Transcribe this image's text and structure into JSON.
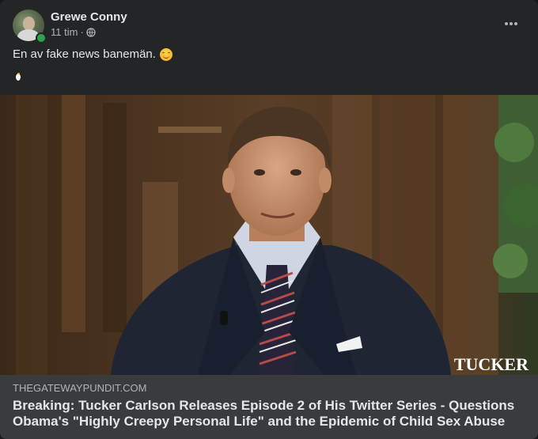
{
  "post": {
    "author": "Grewe Conny",
    "time": "11 tim",
    "separator": "·",
    "text": "En av fake news banemän.",
    "text_emoji": "smiling-face-with-smiling-eyes-icon",
    "second_line_emoji": "penguin-icon",
    "more_icon": "ellipsis-icon",
    "privacy_icon": "globe-icon"
  },
  "link": {
    "domain": "THEGATEWAYPUNDIT.COM",
    "headline": "Breaking: Tucker Carlson Releases Episode 2 of His Twitter Series - Questions Obama's \"Highly Creepy Personal Life\" and the Epidemic of Child Sex Abuse",
    "image_watermark": "TUCKER"
  },
  "colors": {
    "card_bg": "#242526",
    "link_bg": "#3a3b3c",
    "text_primary": "#e4e6eb",
    "text_secondary": "#b0b3b8",
    "online": "#31a24c"
  }
}
